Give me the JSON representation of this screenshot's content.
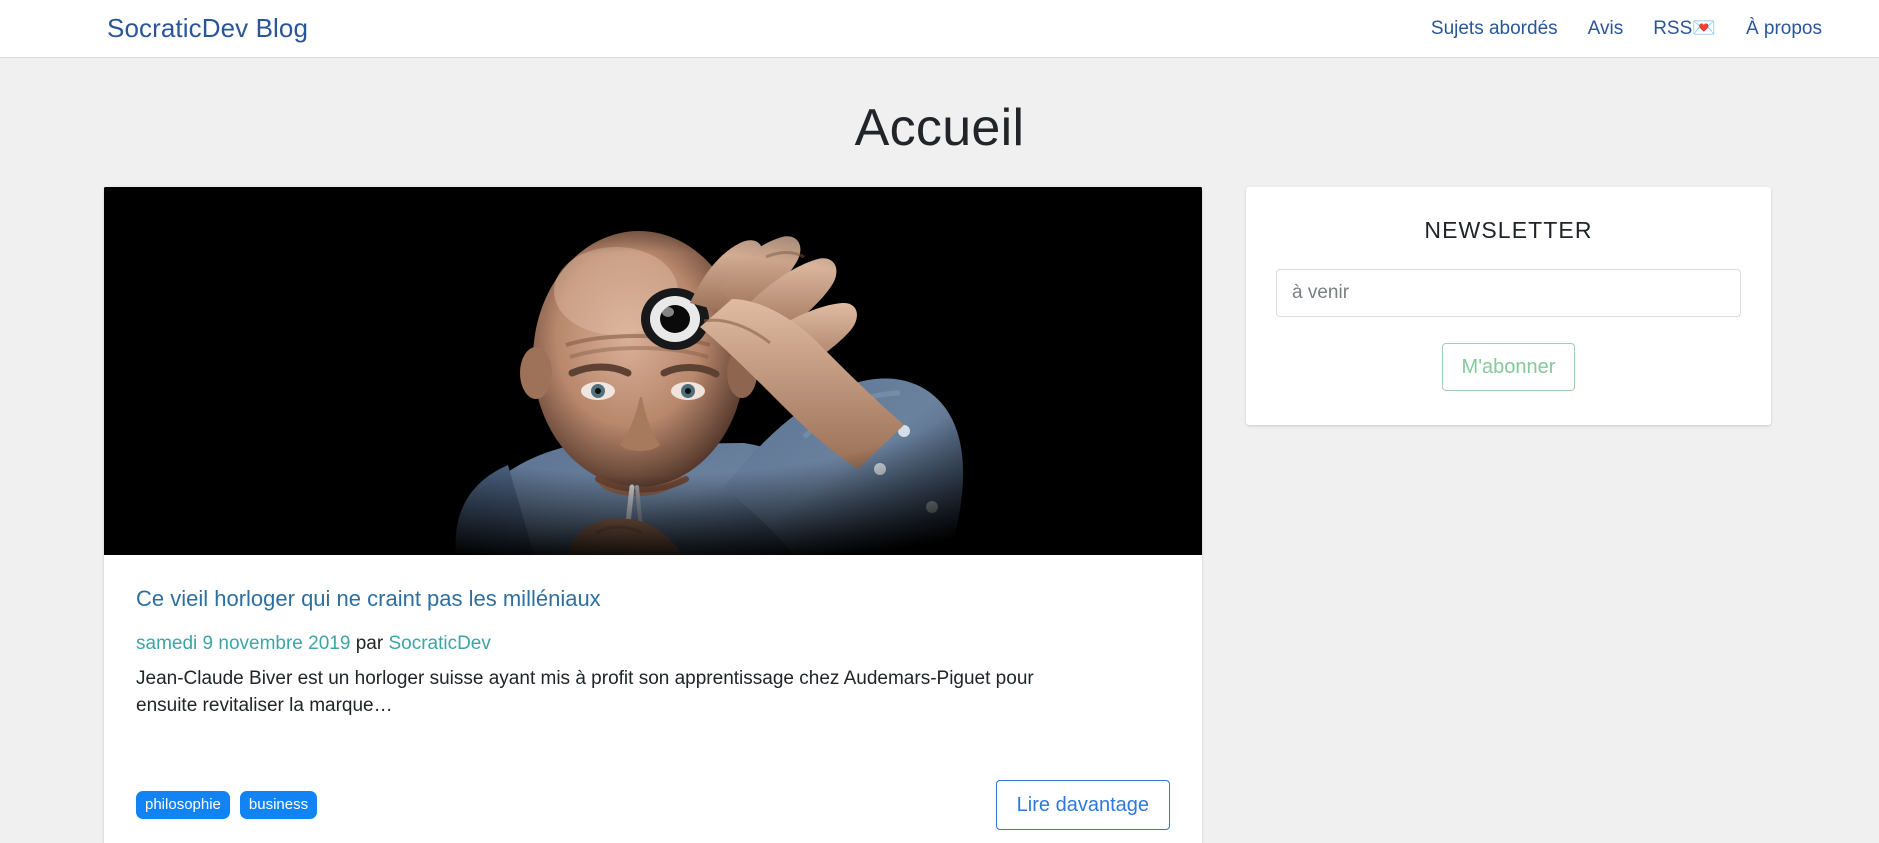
{
  "site": {
    "brand": "SocraticDev Blog"
  },
  "nav": {
    "items": [
      {
        "label": "Sujets abordés",
        "name": "nav-link-topics"
      },
      {
        "label": "Avis",
        "name": "nav-link-reviews"
      },
      {
        "label": "RSS",
        "icon": "love-letter-emoji",
        "icon_glyph": "💌",
        "name": "nav-link-rss"
      },
      {
        "label": "À propos",
        "name": "nav-link-about"
      }
    ]
  },
  "page": {
    "title": "Accueil"
  },
  "article": {
    "image_alt": "Portrait d'un horloger chauve tenant une loupe d'horloger devant son front, fond noir",
    "title": "Ce vieil horloger qui ne craint pas les milléniaux",
    "date": "samedi 9 novembre 2019",
    "by_label": "par",
    "author": "SocraticDev",
    "excerpt": "Jean-Claude Biver est un horloger suisse ayant mis à profit son apprentissage chez Audemars-Piguet pour ensuite revitaliser la marque…",
    "tags": [
      "philosophie",
      "business"
    ],
    "read_more_label": "Lire davantage"
  },
  "newsletter": {
    "heading": "NEWSLETTER",
    "input_value": "",
    "input_placeholder": "à venir",
    "subscribe_label": "M'abonner"
  },
  "colors": {
    "brand_blue": "#2a5599",
    "link_blue": "#2f6f9f",
    "meta_teal": "#3ca5a5",
    "tag_blue": "#1283f5",
    "button_blue": "#2f77e0",
    "subscribe_green": "#83c99a",
    "page_bg": "#f0f0f0",
    "card_bg": "#ffffff"
  }
}
